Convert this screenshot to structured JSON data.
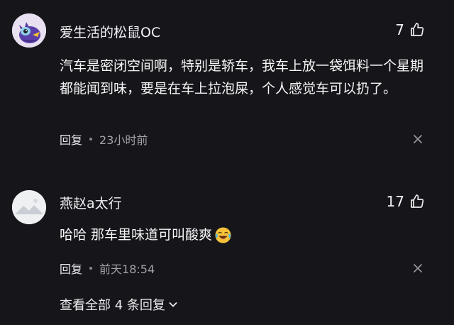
{
  "comments": [
    {
      "username": "爱生活的松鼠OC",
      "likes": "7",
      "text": "汽车是密闭空间啊，特别是轿车，我车上放一袋饵料一个星期都能闻到味，要是在车上拉泡屎，个人感觉车可以扔了。",
      "reply_label": "回复",
      "time": "23小时前",
      "avatar_icon": "bird-avatar-icon"
    },
    {
      "username": "燕赵a太行",
      "likes": "17",
      "text": "哈哈 那车里味道可叫酸爽",
      "reply_label": "回复",
      "time": "前天18:54",
      "avatar_icon": "landscape-avatar-icon",
      "emoji": "laughing-crying-emoji-icon"
    }
  ],
  "view_all_replies": "查看全部 4 条回复",
  "colors": {
    "background": "#16161a",
    "text_primary": "#f2f2f5",
    "text_secondary": "#a2a2aa"
  }
}
